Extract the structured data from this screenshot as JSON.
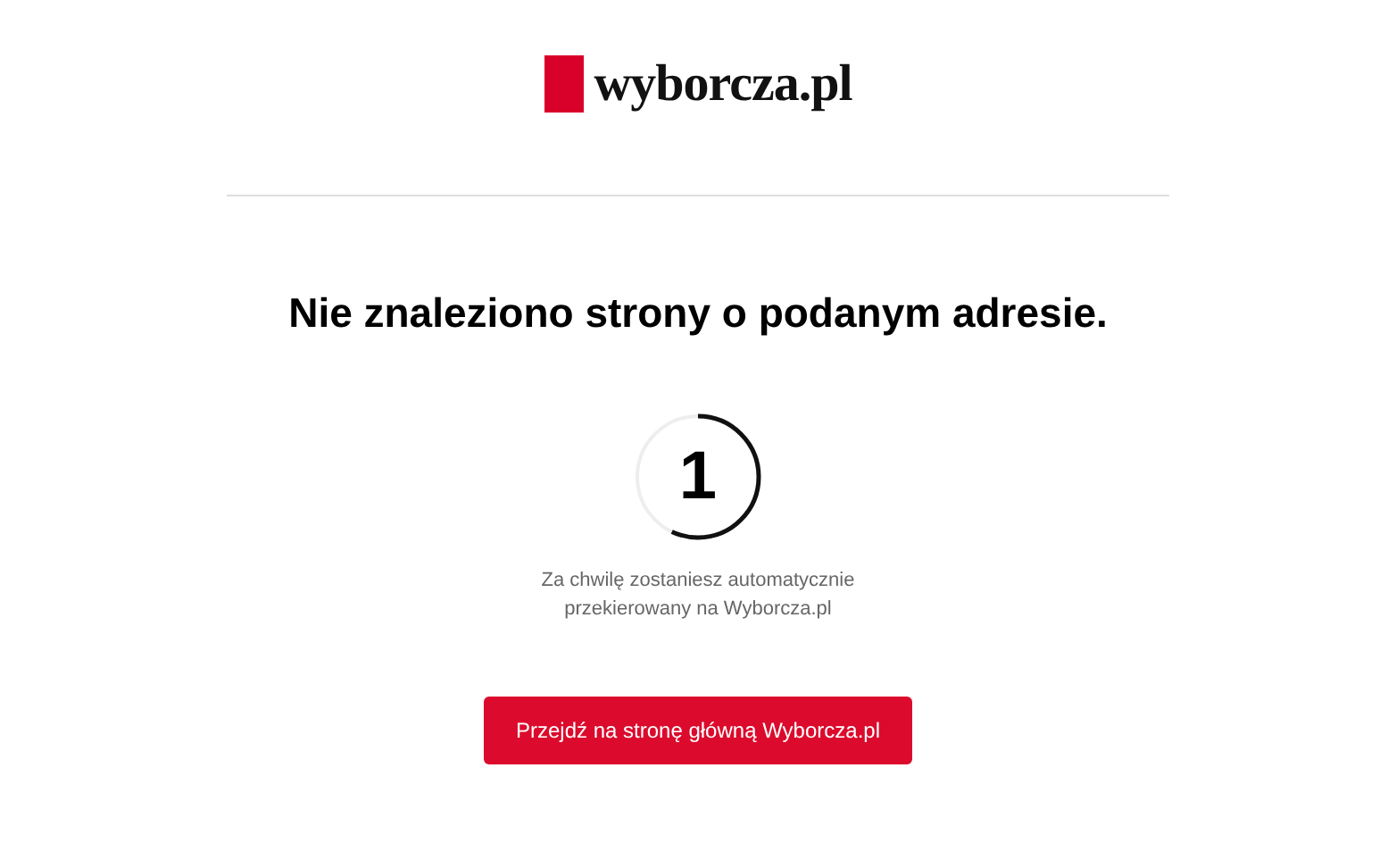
{
  "logo": {
    "text": "wyborcza.pl"
  },
  "heading": "Nie znaleziono strony o podanym adresie.",
  "countdown": {
    "number": "1"
  },
  "message": [
    "Za chwilę zostaniesz automatycznie",
    "przekierowany na Wyborcza.pl"
  ],
  "button": "Przejdź na stronę główną Wyborcza.pl"
}
